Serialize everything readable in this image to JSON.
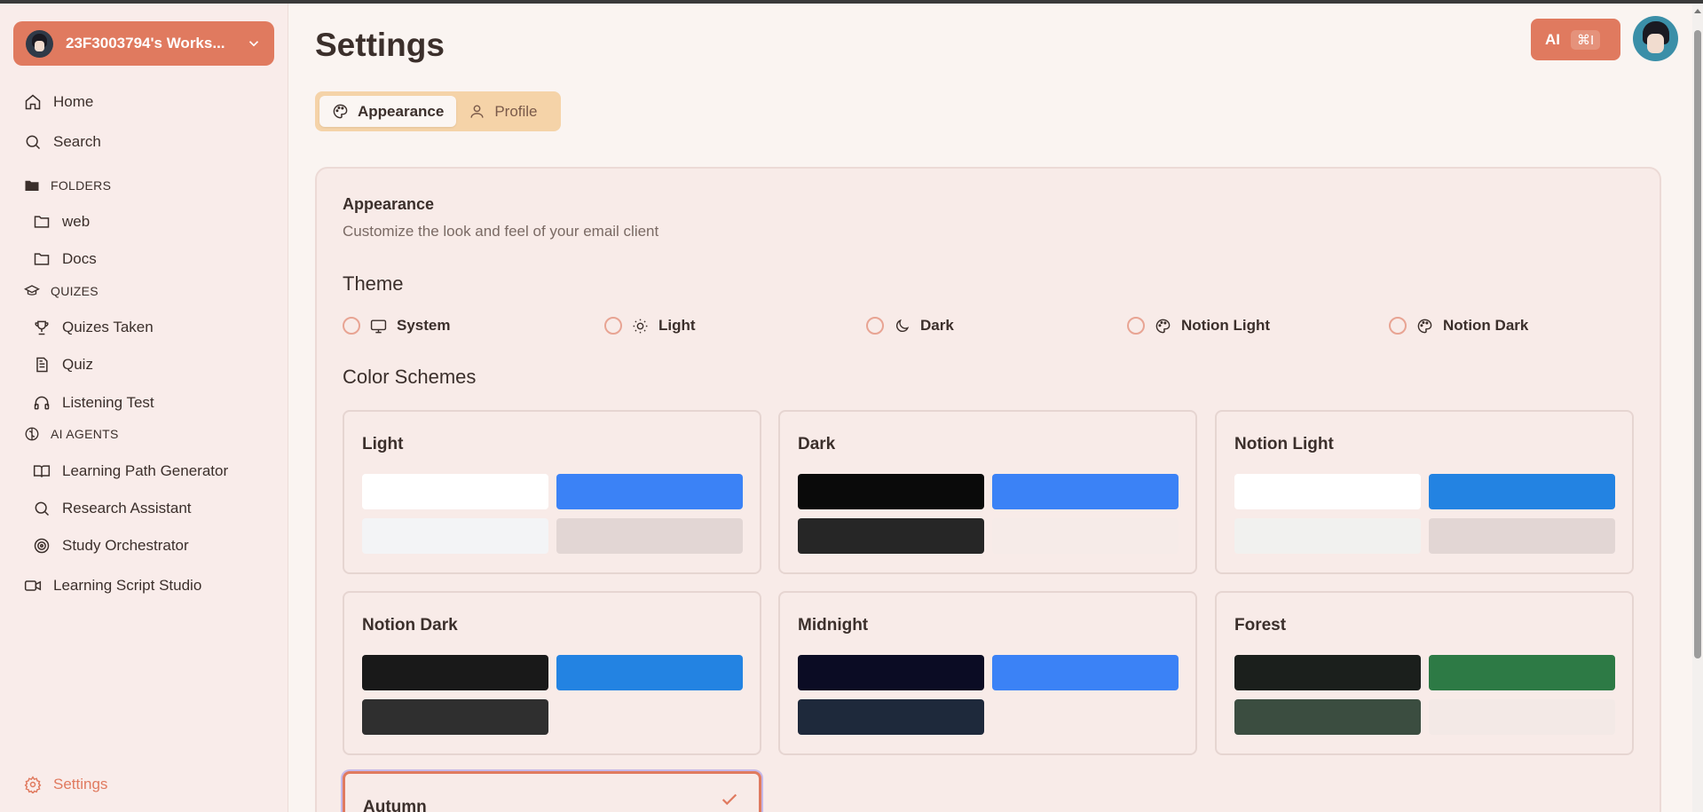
{
  "workspace": {
    "name": "23F3003794's Works..."
  },
  "sidebar": {
    "home": "Home",
    "search": "Search",
    "folders_header": "FOLDERS",
    "folders": [
      "web",
      "Docs"
    ],
    "quizes_header": "QUIZES",
    "quizes": [
      "Quizes Taken",
      "Quiz",
      "Listening Test"
    ],
    "agents_header": "AI AGENTS",
    "agents": [
      "Learning Path Generator",
      "Research Assistant",
      "Study Orchestrator"
    ],
    "studio": "Learning Script Studio",
    "settings": "Settings"
  },
  "header": {
    "title": "Settings",
    "ai_label": "AI",
    "ai_shortcut": "⌘I"
  },
  "tabs": [
    "Appearance",
    "Profile"
  ],
  "appearance": {
    "title": "Appearance",
    "description": "Customize the look and feel of your email client",
    "theme_heading": "Theme",
    "themes": [
      "System",
      "Light",
      "Dark",
      "Notion Light",
      "Notion Dark"
    ],
    "schemes_heading": "Color Schemes",
    "schemes": [
      {
        "name": "Light",
        "colors": [
          "#ffffff",
          "#3b82f6",
          "#f3f4f6",
          "#e2d6d4"
        ]
      },
      {
        "name": "Dark",
        "colors": [
          "#0a0a0a",
          "#3b82f6",
          "#262626",
          "#f6ebe8"
        ]
      },
      {
        "name": "Notion Light",
        "colors": [
          "#ffffff",
          "#2383e2",
          "#f1f1ef",
          "#e2d6d4"
        ]
      },
      {
        "name": "Notion Dark",
        "colors": [
          "#191919",
          "#2383e2",
          "#2f2f2f"
        ]
      },
      {
        "name": "Midnight",
        "colors": [
          "#0b0c24",
          "#3b82f6",
          "#1e293b"
        ]
      },
      {
        "name": "Forest",
        "colors": [
          "#1b1f1c",
          "#2d7a45",
          "#3b4d40",
          "#f3e9e6"
        ]
      },
      {
        "name": "Autumn",
        "colors": []
      }
    ],
    "selected_scheme": "Autumn"
  },
  "colors": {
    "accent": "#e07a5f",
    "tab_bar": "#f5d3a8",
    "sidebar_bg": "#f9ecea"
  }
}
